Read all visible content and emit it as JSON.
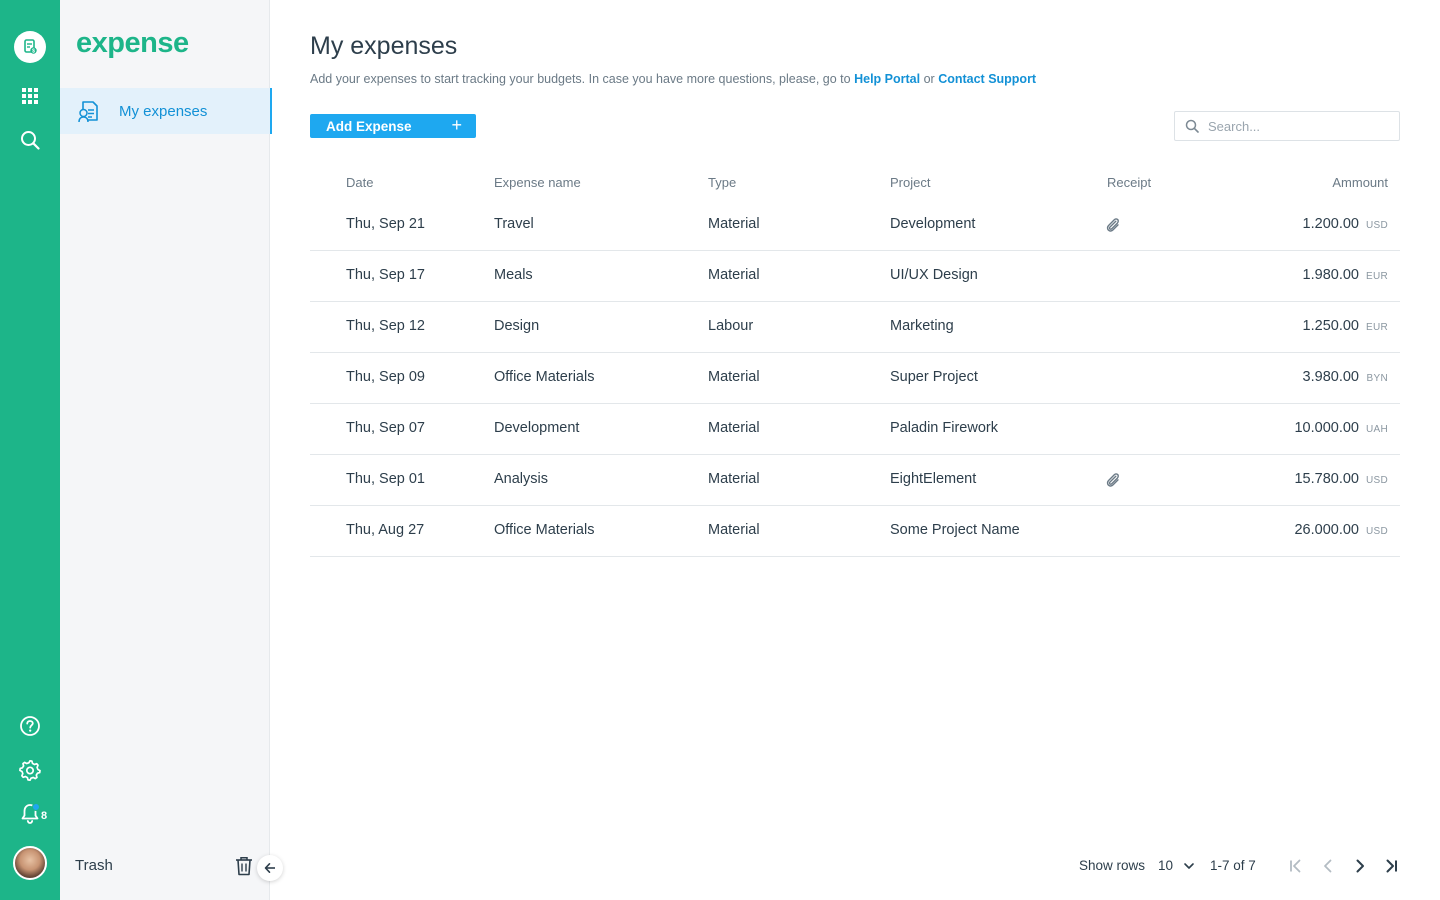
{
  "app": {
    "brand": "expense",
    "colors": {
      "brand_green": "#1db589",
      "accent_blue": "#1ea8f0",
      "link_blue": "#1391d6"
    }
  },
  "rail": {
    "icons": [
      "expense-logo-icon",
      "apps-grid-icon",
      "search-icon",
      "help-icon",
      "settings-icon",
      "bell-icon"
    ],
    "notification_count": "8"
  },
  "sidebar": {
    "nav": [
      {
        "label": "My expenses",
        "icon": "receipt-list-icon",
        "active": true
      }
    ],
    "trash_label": "Trash"
  },
  "header": {
    "title": "My expenses",
    "subtitle_text": "Add your expenses to start tracking your budgets. In case you have more questions, please, go to",
    "help_link": "Help Portal",
    "or_text": "or",
    "support_link": "Contact Support"
  },
  "toolbar": {
    "add_label": "Add Expense",
    "add_plus": "+",
    "search_placeholder": "Search..."
  },
  "table": {
    "columns": [
      "Date",
      "Expense name",
      "Type",
      "Project",
      "Receipt",
      "Ammount"
    ],
    "rows": [
      {
        "date": "Thu, Sep 21",
        "name": "Travel",
        "type": "Material",
        "project": "Development",
        "receipt": true,
        "amount": "1.200.00",
        "currency": "USD"
      },
      {
        "date": "Thu, Sep 17",
        "name": "Meals",
        "type": "Material",
        "project": "UI/UX Design",
        "receipt": false,
        "amount": "1.980.00",
        "currency": "EUR"
      },
      {
        "date": "Thu, Sep 12",
        "name": "Design",
        "type": "Labour",
        "project": "Marketing",
        "receipt": false,
        "amount": "1.250.00",
        "currency": "EUR"
      },
      {
        "date": "Thu, Sep 09",
        "name": "Office Materials",
        "type": "Material",
        "project": "Super Project",
        "receipt": false,
        "amount": "3.980.00",
        "currency": "BYN"
      },
      {
        "date": "Thu, Sep 07",
        "name": "Development",
        "type": "Material",
        "project": "Paladin Firework",
        "receipt": false,
        "amount": "10.000.00",
        "currency": "UAH"
      },
      {
        "date": "Thu, Sep 01",
        "name": "Analysis",
        "type": "Material",
        "project": "EightElement",
        "receipt": true,
        "amount": "15.780.00",
        "currency": "USD"
      },
      {
        "date": "Thu, Aug 27",
        "name": "Office Materials",
        "type": "Material",
        "project": "Some Project Name",
        "receipt": false,
        "amount": "26.000.00",
        "currency": "USD"
      }
    ]
  },
  "pagination": {
    "show_rows_label": "Show rows",
    "rows_value": "10",
    "range": "1-7 of 7"
  }
}
